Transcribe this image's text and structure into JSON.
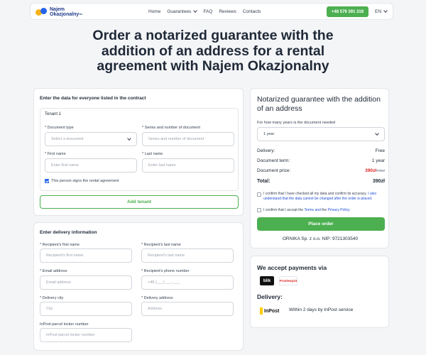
{
  "header": {
    "logo_line1": "Najem",
    "logo_line2": "Okazjonalny",
    "logo_tm": "TM",
    "nav": [
      "Home",
      "Guarantees",
      "FAQ",
      "Reviews",
      "Contacts"
    ],
    "phone": "+48 579 391 318",
    "lang": "EN"
  },
  "page_title": "Order a notarized guarantee with the addition of an address for a rental agreement with Najem Okazjonalny",
  "contract": {
    "heading": "Enter the data for everyone listed in the contract",
    "tenant_label": "Tenant 1",
    "doc_type_label": "* Document type",
    "doc_type_placeholder": "Select a document",
    "series_label": "* Series and number of document",
    "series_placeholder": "Series and number of document",
    "first_name_label": "* First name",
    "first_name_placeholder": "Enter first name",
    "last_name_label": "* Last name",
    "last_name_placeholder": "Enter last name",
    "signs_label": "This person signs the rental agreement",
    "signs_checked": true,
    "add_tenant": "Add tenant"
  },
  "delivery": {
    "heading": "Enter delivery information",
    "rec_first_label": "* Recipient's first name",
    "rec_first_placeholder": "Recipient's first name",
    "rec_last_label": "* Recipient's last name",
    "rec_last_placeholder": "Recipient's last name",
    "email_label": "* Email address",
    "email_placeholder": "Email address",
    "phone_label": "* Recipient's phone number",
    "phone_placeholder": "+48 (___) ___-___",
    "city_label": "* Delivery city",
    "city_placeholder": "City",
    "address_label": "* Delivery address",
    "address_placeholder": "Address",
    "locker_label": "InPost parcel locker number",
    "locker_placeholder": "InPost parcel locker number"
  },
  "order": {
    "title": "Notarized guarantee with the addition of an address",
    "years_label": "For how many years is the document needed",
    "years_value": "1 year",
    "delivery_label": "Delivery:",
    "delivery_value": "Free",
    "term_label": "Document term:",
    "term_value": "1 year",
    "price_label": "Document price:",
    "price_value": "390zł",
    "price_old": "415zł",
    "total_label": "Total:",
    "total_value": "390zł",
    "consent1_a": "I confirm that I have checked all my data and confirm its accuracy.",
    "consent1_b": "I also understand that the data cannot be changed after the order is placed.",
    "consent2_a": "I confirm that I accept the ",
    "consent2_b": "Terms and",
    "consent2_c": " the ",
    "consent2_d": "Privacy Policy",
    "place_order": "Place order",
    "company": "ORNIKA Sp. z o.o. NIP: 9721303540"
  },
  "payments": {
    "title": "We accept payments via",
    "blik": "blik",
    "p24": "Przelewy24",
    "delivery_title": "Delivery:",
    "inpost_logo": "InPost",
    "inpost_text": "Within 2 days by InPost service"
  },
  "colors": {
    "green": "#4caf50",
    "blue": "#2563eb",
    "red": "#dc2626"
  }
}
